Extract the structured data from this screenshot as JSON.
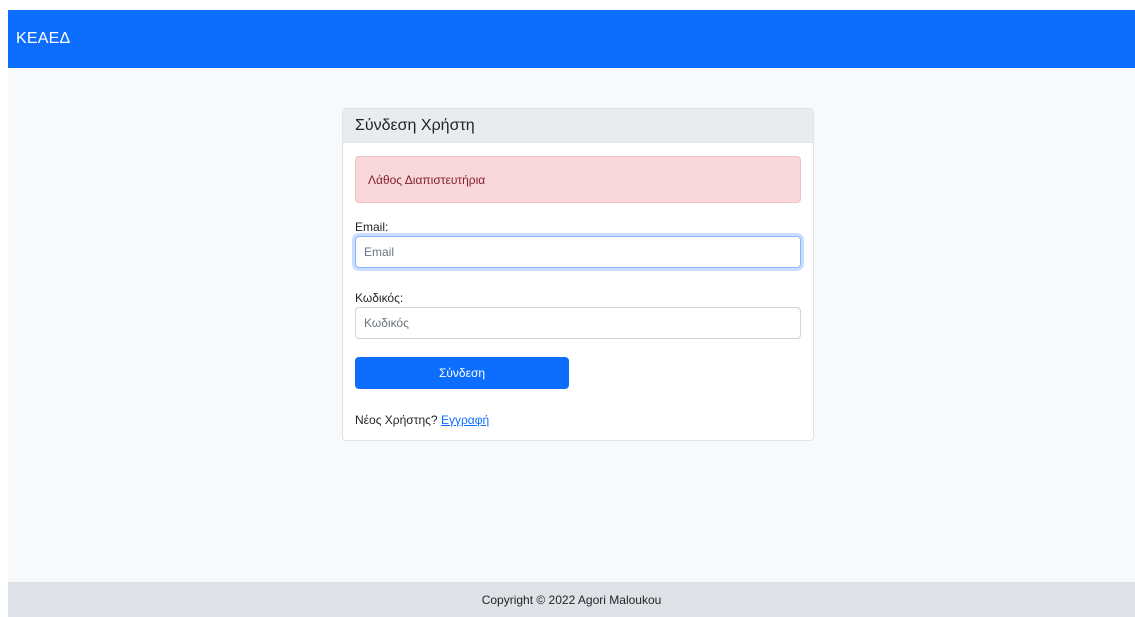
{
  "navbar": {
    "brand": "ΚΕΑΕΔ"
  },
  "login_card": {
    "title": "Σύνδεση Χρήστη",
    "error_message": "Λάθος Διαπιστευτήρια",
    "email": {
      "label": "Email:",
      "placeholder": "Email",
      "value": ""
    },
    "password": {
      "label": "Κωδικός:",
      "placeholder": "Κωδικός",
      "value": ""
    },
    "submit_label": "Σύνδεση",
    "new_user_text": "Νέος Χρήστης?",
    "register_link": "Εγγραφή"
  },
  "footer": {
    "copyright": "Copyright © 2022 Agori Maloukou"
  },
  "colors": {
    "primary": "#0d6efd",
    "alert_background": "#f8d7da",
    "alert_text": "#842029",
    "card_header": "#e9ecef",
    "footer_background": "#dee2e6"
  }
}
